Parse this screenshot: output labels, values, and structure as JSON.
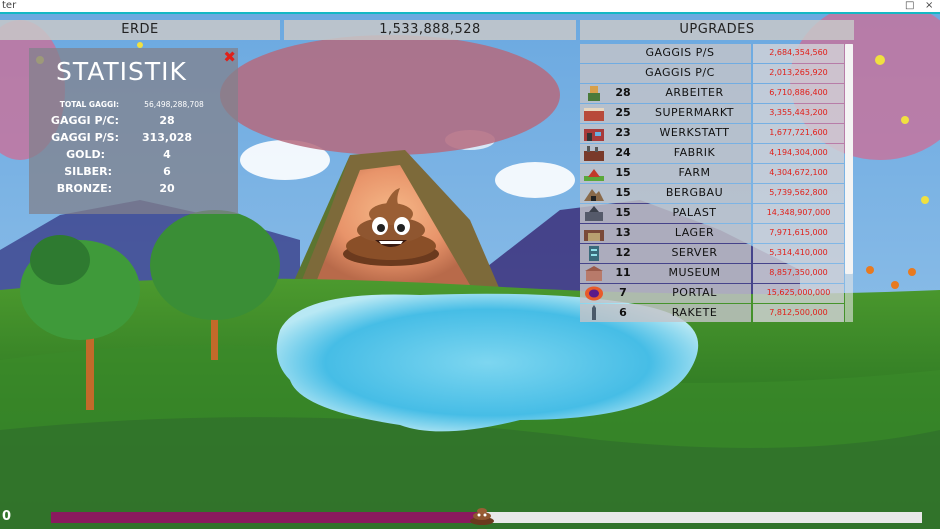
{
  "window": {
    "title_fragment": "ter",
    "close_glyph": "×",
    "max_glyph": "□"
  },
  "header": {
    "world_label": "ERDE",
    "gaggi_total": "1,533,888,528",
    "upgrades_label": "UPGRADES"
  },
  "stats": {
    "title": "STATISTIK",
    "close_glyph": "✖",
    "rows": [
      {
        "label": "TOTAL GAGGI:",
        "value": "56,498,288,708"
      },
      {
        "label": "GAGGI P/C:",
        "value": "28"
      },
      {
        "label": "GAGGI P/S:",
        "value": "313,028"
      },
      {
        "label": "GOLD:",
        "value": "4"
      },
      {
        "label": "SILBER:",
        "value": "6"
      },
      {
        "label": "BRONZE:",
        "value": "20"
      }
    ]
  },
  "upgrades": {
    "top_rows": [
      {
        "name": "GAGGIS P/S",
        "cost": "2,684,354,560"
      },
      {
        "name": "GAGGIS P/C",
        "cost": "2,013,265,920"
      }
    ],
    "items": [
      {
        "count": "28",
        "name": "ARBEITER",
        "cost": "6,710,886,400",
        "icon": "worker-icon"
      },
      {
        "count": "25",
        "name": "SUPERMARKT",
        "cost": "3,355,443,200",
        "icon": "supermarket-icon"
      },
      {
        "count": "23",
        "name": "WERKSTATT",
        "cost": "1,677,721,600",
        "icon": "workshop-icon"
      },
      {
        "count": "24",
        "name": "FABRIK",
        "cost": "4,194,304,000",
        "icon": "factory-icon"
      },
      {
        "count": "15",
        "name": "FARM",
        "cost": "4,304,672,100",
        "icon": "farm-icon"
      },
      {
        "count": "15",
        "name": "BERGBAU",
        "cost": "5,739,562,800",
        "icon": "mine-icon"
      },
      {
        "count": "15",
        "name": "PALAST",
        "cost": "14,348,907,000",
        "icon": "palace-icon"
      },
      {
        "count": "13",
        "name": "LAGER",
        "cost": "7,971,615,000",
        "icon": "warehouse-icon"
      },
      {
        "count": "12",
        "name": "SERVER",
        "cost": "5,314,410,000",
        "icon": "server-icon"
      },
      {
        "count": "11",
        "name": "MUSEUM",
        "cost": "8,857,350,000",
        "icon": "museum-icon"
      },
      {
        "count": "7",
        "name": "PORTAL",
        "cost": "15,625,000,000",
        "icon": "portal-icon"
      },
      {
        "count": "6",
        "name": "RAKETE",
        "cost": "7,812,500,000",
        "icon": "rocket-icon"
      }
    ]
  },
  "progress": {
    "value_label": "0",
    "fraction": 0.497
  },
  "colors": {
    "accent_red": "#e0201a",
    "progress_fill": "#8a1a5e"
  }
}
